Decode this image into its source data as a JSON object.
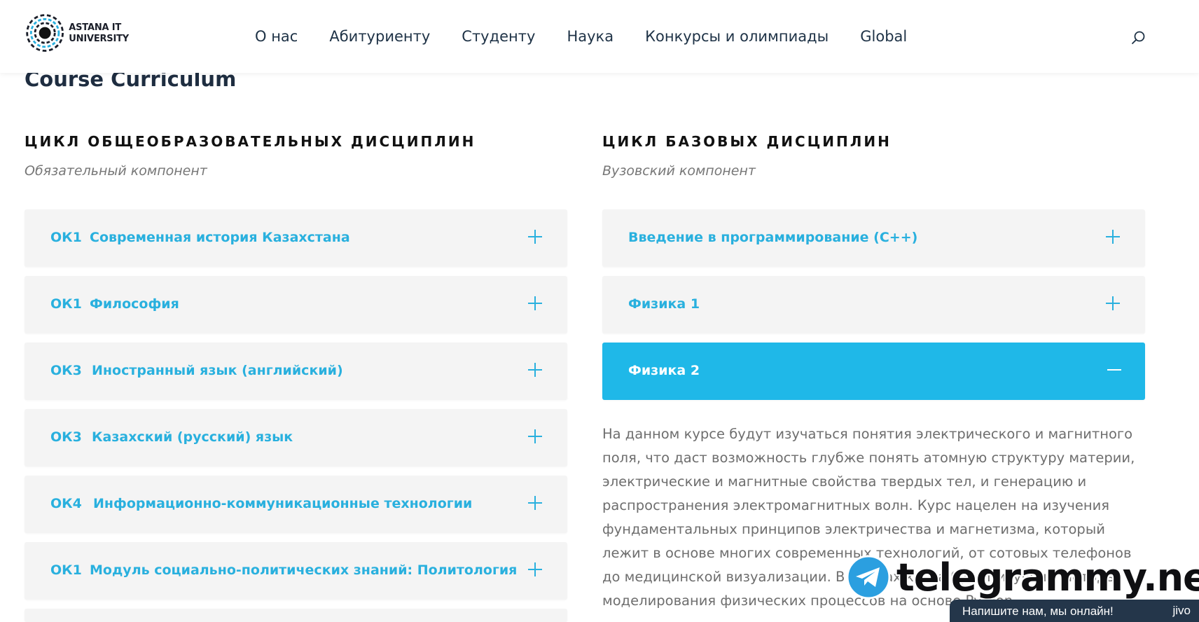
{
  "header": {
    "logo_line1": "ASTANA IT",
    "logo_line2": "UNIVERSITY",
    "nav": [
      {
        "label": "О нас"
      },
      {
        "label": "Абитуриенту"
      },
      {
        "label": "Студенту"
      },
      {
        "label": "Наука"
      },
      {
        "label": "Конкурсы и олимпиады"
      },
      {
        "label": "Global"
      }
    ],
    "search_icon": "search-icon"
  },
  "page_title": "Course Curriculum",
  "left": {
    "title": "ЦИКЛ ОБЩЕОБРАЗОВАТЕЛЬНЫХ ДИСЦИПЛИН",
    "subtitle": "Обязательный компонент",
    "items": [
      {
        "code": "ОК1",
        "label": "Современная история Казахстана"
      },
      {
        "code": "ОК1",
        "label": "Философия"
      },
      {
        "code": "ОК3",
        "label": "Иностранный язык (английский)"
      },
      {
        "code": "ОК3",
        "label": "Казахский (русский) язык"
      },
      {
        "code": "ОК4",
        "label": "Информационно-коммуникационные технологии"
      },
      {
        "code": "ОК1",
        "label": "Модуль социально-политических знаний: Политология"
      }
    ]
  },
  "right": {
    "title": "ЦИКЛ БАЗОВЫХ ДИСЦИПЛИН",
    "subtitle": "Вузовский компонент",
    "items": [
      {
        "label": "Введение в программирование (C++)"
      },
      {
        "label": "Физика 1"
      },
      {
        "label": "Физика 2",
        "expanded": true
      }
    ],
    "description": "На данном курсе будут изучаться понятия электрического и магнитного поля, что даст возможность глубже понять атомную структуру материи, электрические и магнитные свойства твердых тел, и генерацию и распространения электромагнитных волн. Курс нацелен на изучения фундаментальных принципов электричества и магнетизма, который лежит в основе многих современных технологий, от сотовых телефонов до медицинской визуализации. В рамках курса будут изучены методы моделирования физических процессов на основе Python."
  },
  "watermark": "telegrammy.net",
  "chat": {
    "text": "Напишите нам, мы онлайн!",
    "brand": "jivo"
  },
  "colors": {
    "accent": "#29b0de",
    "active_bg": "#1fb8e8",
    "card_bg": "#f4f4f4",
    "chat_bg": "#24364a"
  }
}
